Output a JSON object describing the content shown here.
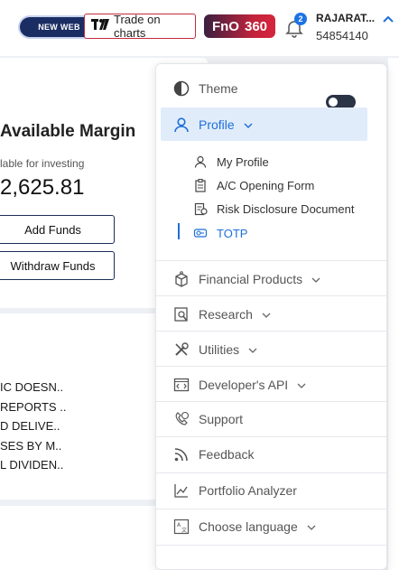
{
  "topbar": {
    "new_web_label": "NEW WEB",
    "trade_label": "Trade on charts",
    "trade_logo": "TV",
    "fno_label": "FnO",
    "fno_value": "360",
    "notification_count": "2",
    "user_name": "RAJARAT...",
    "user_id": "54854140"
  },
  "margin_card": {
    "title": "Available Margin",
    "subtitle": "lable for investing",
    "value": "2,625.81",
    "add_funds_label": "Add Funds",
    "withdraw_funds_label": "Withdraw Funds"
  },
  "news_card": {
    "items": [
      "IC DOESN..",
      "REPORTS ..",
      "D DELIVE..",
      "SES BY M..",
      "L DIVIDEN.."
    ]
  },
  "menu": {
    "theme_label": "Theme",
    "profile_label": "Profile",
    "profile_items": [
      {
        "label": "My Profile",
        "icon": "user-icon"
      },
      {
        "label": "A/C Opening Form",
        "icon": "form-icon"
      },
      {
        "label": "Risk Disclosure Document",
        "icon": "document-icon"
      },
      {
        "label": "TOTP",
        "icon": "key-icon"
      }
    ],
    "items": [
      {
        "label": "Financial Products",
        "icon": "box-icon",
        "has_chevron": true
      },
      {
        "label": "Research",
        "icon": "research-icon",
        "has_chevron": true
      },
      {
        "label": "Utilities",
        "icon": "tools-icon",
        "has_chevron": true
      },
      {
        "label": "Developer's API",
        "icon": "code-icon",
        "has_chevron": true
      },
      {
        "label": "Support",
        "icon": "support-icon",
        "has_chevron": false
      },
      {
        "label": "Feedback",
        "icon": "feedback-icon",
        "has_chevron": false
      },
      {
        "label": "Portfolio Analyzer",
        "icon": "chart-icon",
        "has_chevron": false
      },
      {
        "label": "Choose language",
        "icon": "language-icon",
        "has_chevron": true
      }
    ]
  },
  "colors": {
    "accent": "#1e6fd9",
    "profile_highlight": "#e1ecfb",
    "brand_dark": "#1b2e63",
    "trade_border": "#c52b3b"
  }
}
